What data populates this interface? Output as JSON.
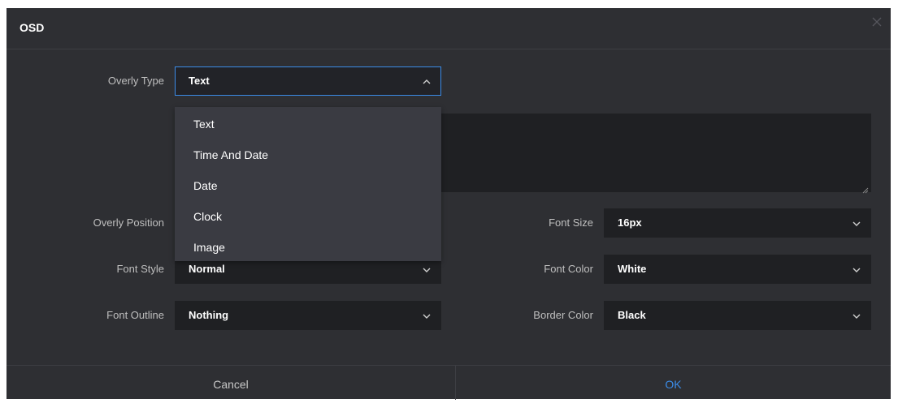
{
  "dialog": {
    "title": "OSD",
    "close_icon": "close-icon"
  },
  "form": {
    "overlay_type": {
      "label": "Overly Type",
      "value": "Text",
      "expanded": true
    },
    "overlay_position": {
      "label": "Overly Position"
    },
    "font_style": {
      "label": "Font Style",
      "value": "Normal"
    },
    "font_outline": {
      "label": "Font Outline",
      "value": "Nothing"
    },
    "font_size": {
      "label": "Font Size",
      "value": "16px"
    },
    "font_color": {
      "label": "Font Color",
      "value": "White"
    },
    "border_color": {
      "label": "Border Color",
      "value": "Black"
    },
    "text_content": {
      "value": ""
    }
  },
  "dropdown": {
    "options": [
      {
        "label": "Text"
      },
      {
        "label": "Time And Date"
      },
      {
        "label": "Date"
      },
      {
        "label": "Clock"
      },
      {
        "label": "Image"
      }
    ]
  },
  "footer": {
    "cancel_label": "Cancel",
    "ok_label": "OK"
  },
  "colors": {
    "background": "#2e2f33",
    "field": "#1f2023",
    "dropdown": "#3a3b42",
    "accent": "#3b8ce8"
  }
}
